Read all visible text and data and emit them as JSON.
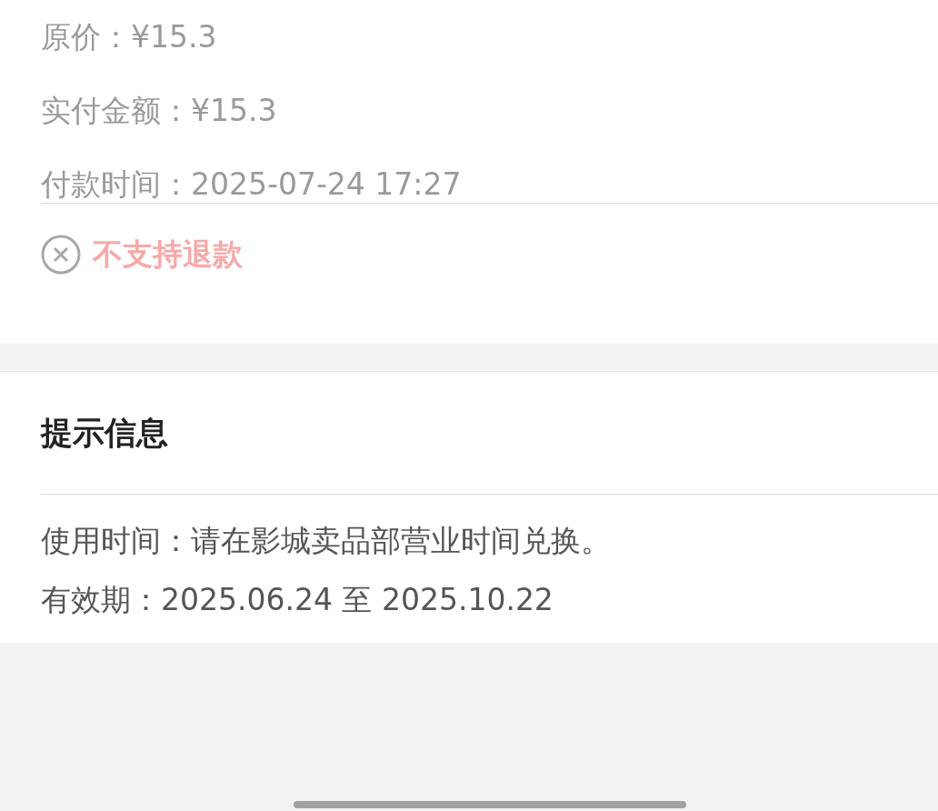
{
  "order_rows": [
    "原价：¥15.3",
    "实付金额：¥15.3",
    "付款时间：2025-07-24 17:27"
  ],
  "refund": {
    "text": "不支持退款",
    "supported": false
  },
  "tips": {
    "title": "提示信息",
    "lines": [
      "使用时间：请在影城卖品部营业时间兑换。",
      "有效期：2025.06.24 至 2025.10.22"
    ]
  }
}
